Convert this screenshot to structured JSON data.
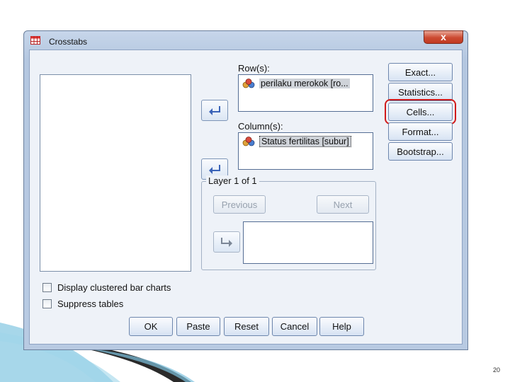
{
  "window": {
    "title": "Crosstabs",
    "close_label": "x"
  },
  "variables": {
    "available": []
  },
  "rows": {
    "label": "Row(s):",
    "items": [
      "perilaku merokok [ro..."
    ]
  },
  "columns": {
    "label": "Column(s):",
    "items": [
      "Status fertilitas [subur]"
    ]
  },
  "layer": {
    "title": "Layer 1 of 1",
    "previous_label": "Previous",
    "next_label": "Next",
    "items": []
  },
  "side_buttons": {
    "exact": "Exact...",
    "statistics": "Statistics...",
    "cells": "Cells...",
    "format": "Format...",
    "bootstrap": "Bootstrap..."
  },
  "options": {
    "clustered_bar": {
      "label": "Display clustered bar charts",
      "checked": false
    },
    "suppress_tables": {
      "label": "Suppress tables",
      "checked": false
    }
  },
  "footer_buttons": {
    "ok": "OK",
    "paste": "Paste",
    "reset": "Reset",
    "cancel": "Cancel",
    "help": "Help"
  },
  "highlighted_button": "cells",
  "page_number": "20",
  "colors": {
    "highlight": "#d11a1a",
    "selection": "#cfd3d9",
    "arrow": "#3a63b8"
  }
}
